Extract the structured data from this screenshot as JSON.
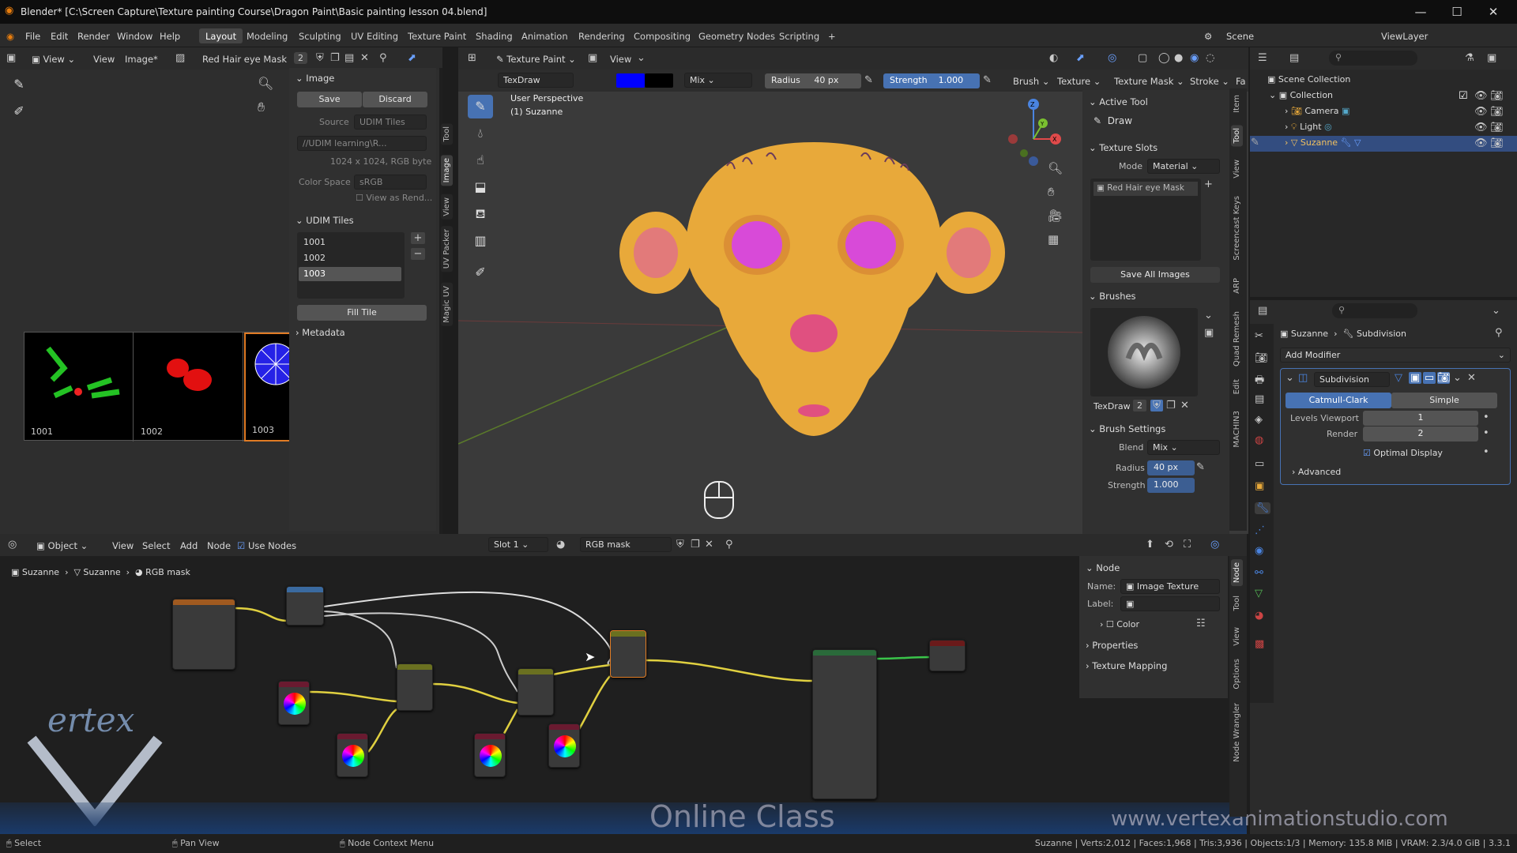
{
  "window": {
    "title": "Blender* [C:\\Screen Capture\\Texture painting Course\\Dragon Paint\\Basic painting lesson 04.blend]",
    "minimize": "—",
    "maximize": "☐",
    "close": "✕"
  },
  "menu": {
    "items": [
      "File",
      "Edit",
      "Render",
      "Window",
      "Help"
    ],
    "workspaces": [
      "Layout",
      "Modeling",
      "Sculpting",
      "UV Editing",
      "Texture Paint",
      "Shading",
      "Animation",
      "Rendering",
      "Compositing",
      "Geometry Nodes",
      "Scripting"
    ],
    "active_workspace": "Layout",
    "add_tab": "+",
    "scene": "Scene",
    "view_layer": "ViewLayer"
  },
  "image_editor": {
    "header": {
      "view_menu": "View",
      "view": "View",
      "image_menu": "Image*",
      "image_name": "Red Hair eye Mask",
      "users": "2"
    },
    "image_panel": {
      "title": "Image",
      "save": "Save",
      "discard": "Discard",
      "source_label": "Source",
      "source": "UDIM Tiles",
      "path": "//UDIM learning\\R...",
      "info": "1024 x 1024,  RGB byte",
      "color_space_label": "Color Space",
      "color_space": "sRGB",
      "view_as_render": "View as Rend..."
    },
    "udim_panel": {
      "title": "UDIM Tiles",
      "tiles": [
        "1001",
        "1002",
        "1003"
      ],
      "selected": "1003",
      "fill_tile": "Fill Tile"
    },
    "metadata": "Metadata",
    "thumbs": [
      "1001",
      "1002",
      "1003"
    ],
    "vtabs": [
      "Tool",
      "Image",
      "View",
      "UV Packer",
      "Magic UV"
    ]
  },
  "viewport": {
    "header": {
      "mode": "Texture Paint",
      "view": "View",
      "brush_name": "TexDraw",
      "blend": "Mix",
      "radius_label": "Radius",
      "radius": "40 px",
      "strength_label": "Strength",
      "strength": "1.000",
      "brush": "Brush",
      "texture": "Texture",
      "texture_mask": "Texture Mask",
      "stroke": "Stroke",
      "falloff": "Fa"
    },
    "overlay_title": "User Perspective",
    "overlay_object": "(1) Suzanne",
    "gizmo": {
      "x": "X",
      "y": "Y",
      "z": "Z"
    },
    "vtabs": [
      "Item",
      "Tool",
      "View",
      "Screencast Keys",
      "ARP",
      "Quad Remesh",
      "Edit",
      "MACHIN3"
    ]
  },
  "tool_panel": {
    "active_tool": {
      "title": "Active Tool",
      "name": "Draw"
    },
    "texture_slots": {
      "title": "Texture Slots",
      "mode_label": "Mode",
      "mode": "Material",
      "slot": "Red Hair eye Mask",
      "save_all": "Save All Images"
    },
    "brushes": {
      "title": "Brushes",
      "brush_name": "TexDraw",
      "users": "2"
    },
    "brush_settings": {
      "title": "Brush Settings",
      "blend_label": "Blend",
      "blend": "Mix",
      "radius_label": "Radius",
      "radius": "40 px",
      "strength_label": "Strength",
      "strength": "1.000"
    }
  },
  "outliner": {
    "title": "Scene Collection",
    "items": [
      {
        "name": "Collection",
        "indent": 1
      },
      {
        "name": "Camera",
        "indent": 2
      },
      {
        "name": "Light",
        "indent": 2
      },
      {
        "name": "Suzanne",
        "indent": 2
      }
    ]
  },
  "properties": {
    "breadcrumb": [
      "Suzanne",
      "Subdivision"
    ],
    "add_modifier": "Add Modifier",
    "modifier": {
      "name": "Subdivision",
      "catmull": "Catmull-Clark",
      "simple": "Simple",
      "levels_label": "Levels Viewport",
      "levels": "1",
      "render_label": "Render",
      "render": "2",
      "optimal": "Optimal Display",
      "advanced": "Advanced"
    }
  },
  "node_editor": {
    "header": {
      "editor": "Object",
      "view": "View",
      "select": "Select",
      "add": "Add",
      "node": "Node",
      "use_nodes": "Use Nodes",
      "slot": "Slot 1",
      "material": "RGB mask"
    },
    "breadcrumb": [
      "Suzanne",
      "Suzanne",
      "RGB mask"
    ],
    "side": {
      "title": "Node",
      "name_label": "Name:",
      "name": "Image Texture",
      "label_label": "Label:",
      "label": "",
      "color": "Color",
      "properties": "Properties",
      "texture_mapping": "Texture Mapping"
    },
    "vtabs": [
      "Node",
      "Tool",
      "View",
      "Options",
      "Node Wrangler"
    ],
    "watermark": "Online Class",
    "url": "www.vertexanimationstudio.com"
  },
  "status": {
    "select": "Select",
    "pan": "Pan View",
    "context": "Node Context Menu",
    "stats": "Suzanne | Verts:2,012 | Faces:1,968 | Tris:3,936 | Objects:1/3 | Memory: 135.8 MiB | VRAM: 2.3/4.0 GiB | 3.3.1"
  },
  "colors": {
    "accent": "#4772b3",
    "selected": "#334d80",
    "paint_color": "#0000ff",
    "suzanne": "#e8a93a",
    "eyes": "#d84ad8"
  }
}
